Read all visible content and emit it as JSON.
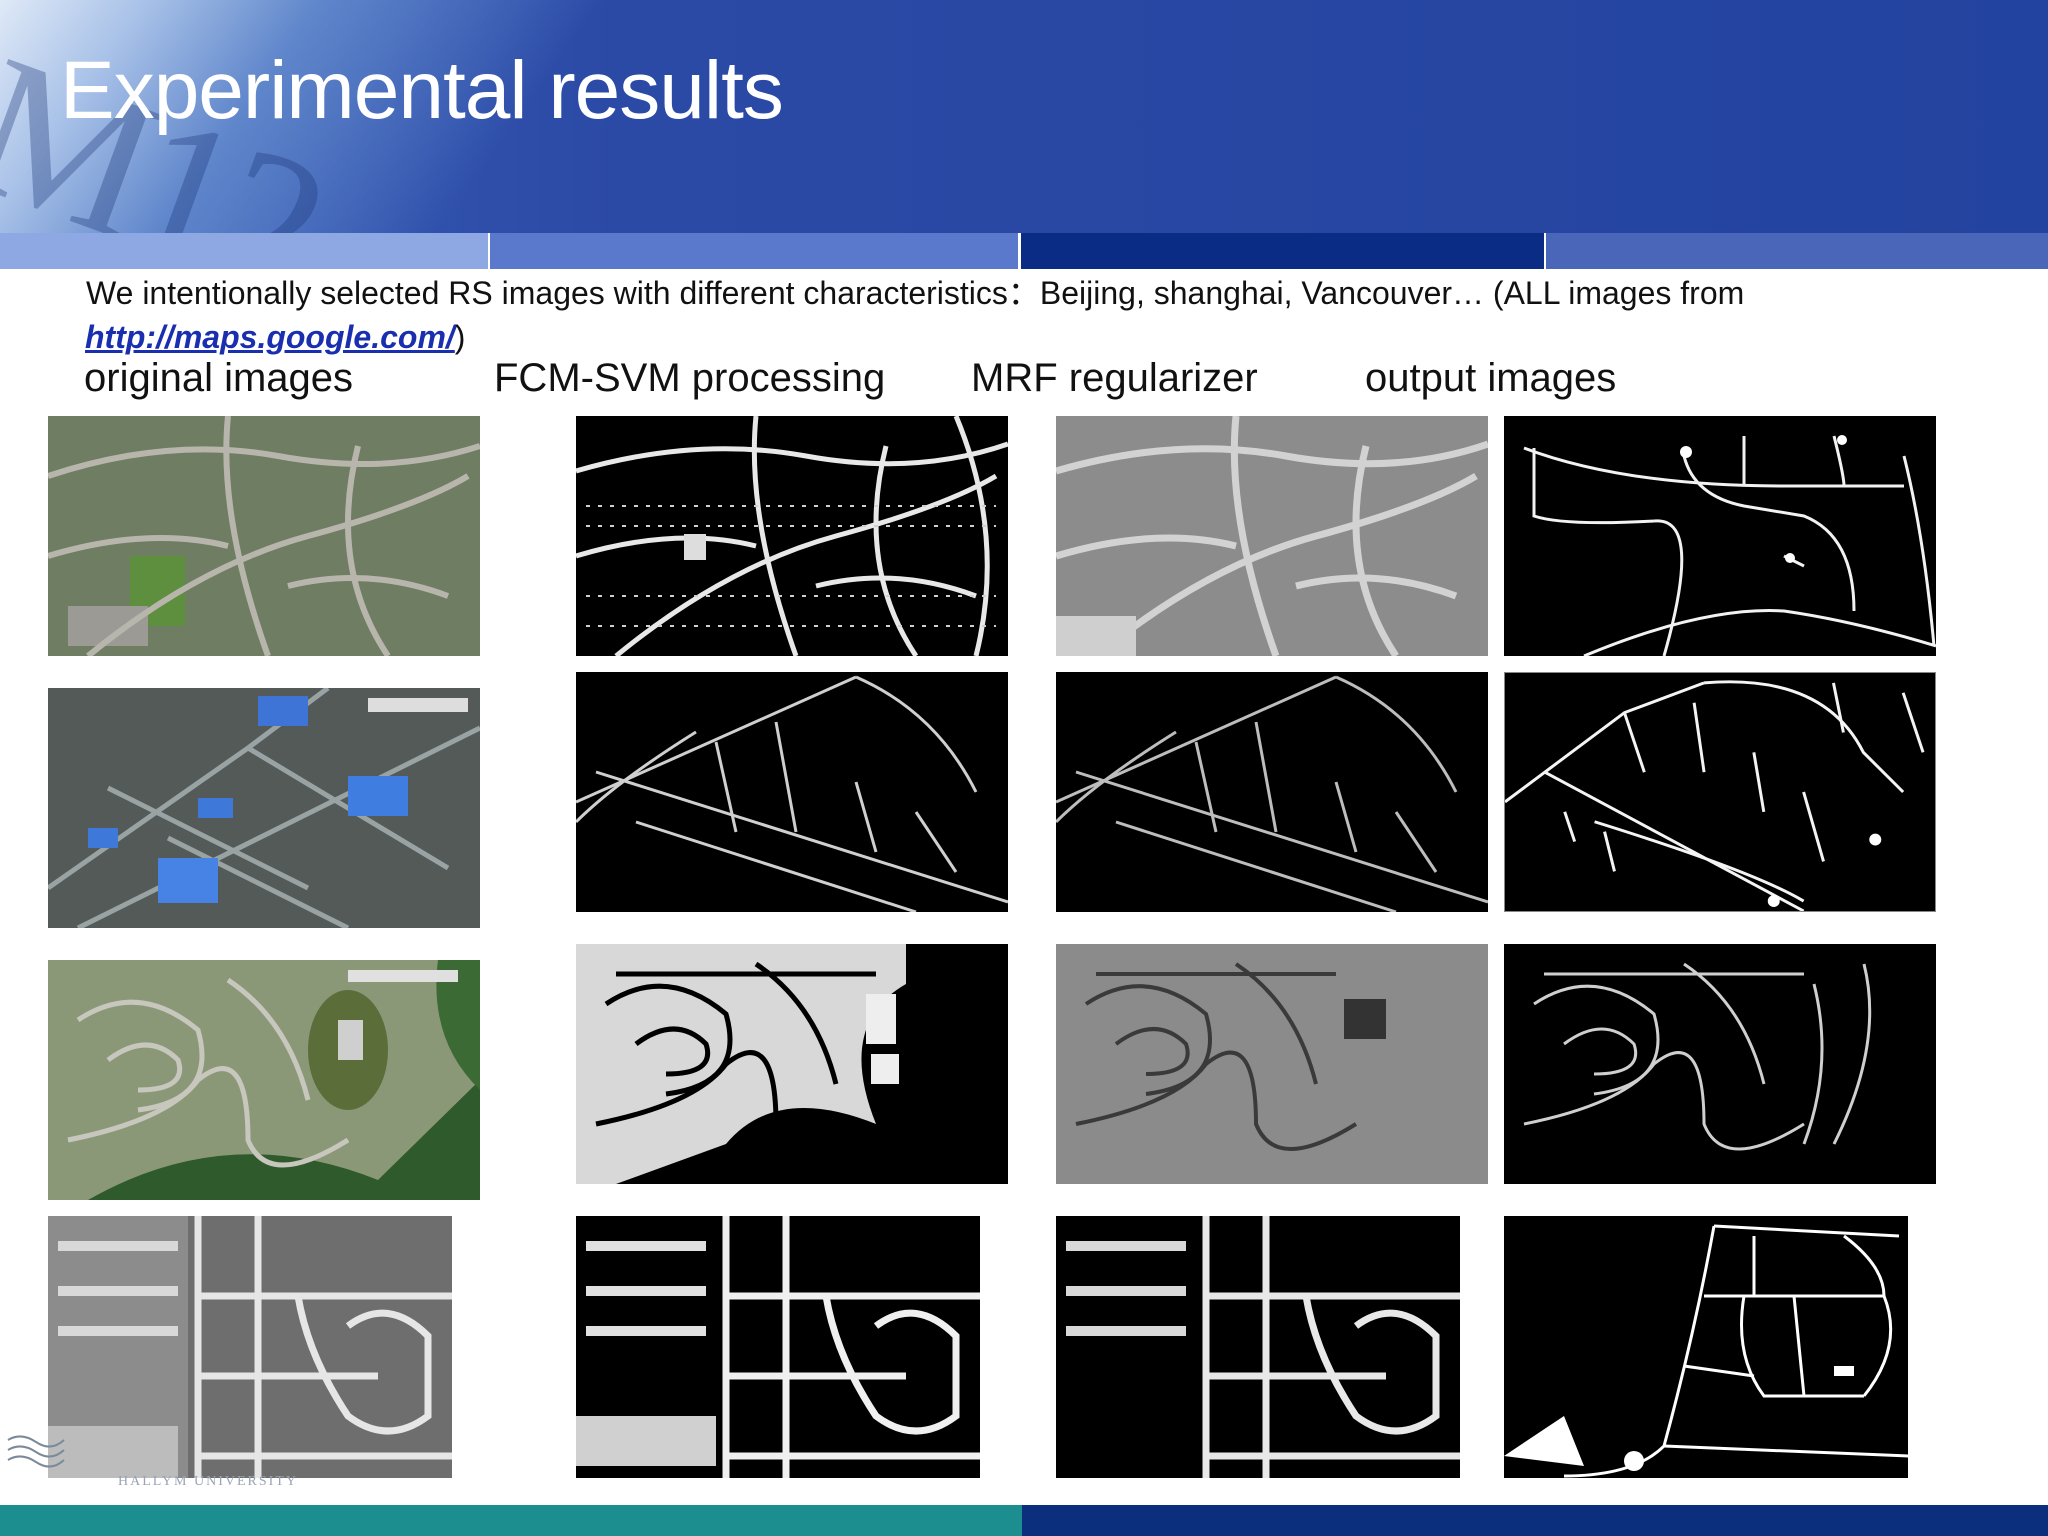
{
  "slide": {
    "title": "Experimental results",
    "intro": "We intentionally selected RS images with different characteristics：Beijing,   shanghai,   Vancouver…  (ALL images from",
    "link": "http://maps.google.com/",
    "link_close": ")"
  },
  "columns": {
    "original": "original images",
    "fcm": "FCM-SVM processing",
    "mrf": "MRF regularizer",
    "output": "output images"
  },
  "footer": {
    "university": "HALLYM UNIVERSITY"
  },
  "colors": {
    "header": "#2b4aa6",
    "link": "#1a2fb0",
    "footer_teal": "#1d8e8f",
    "footer_navy": "#0b2f7d"
  }
}
